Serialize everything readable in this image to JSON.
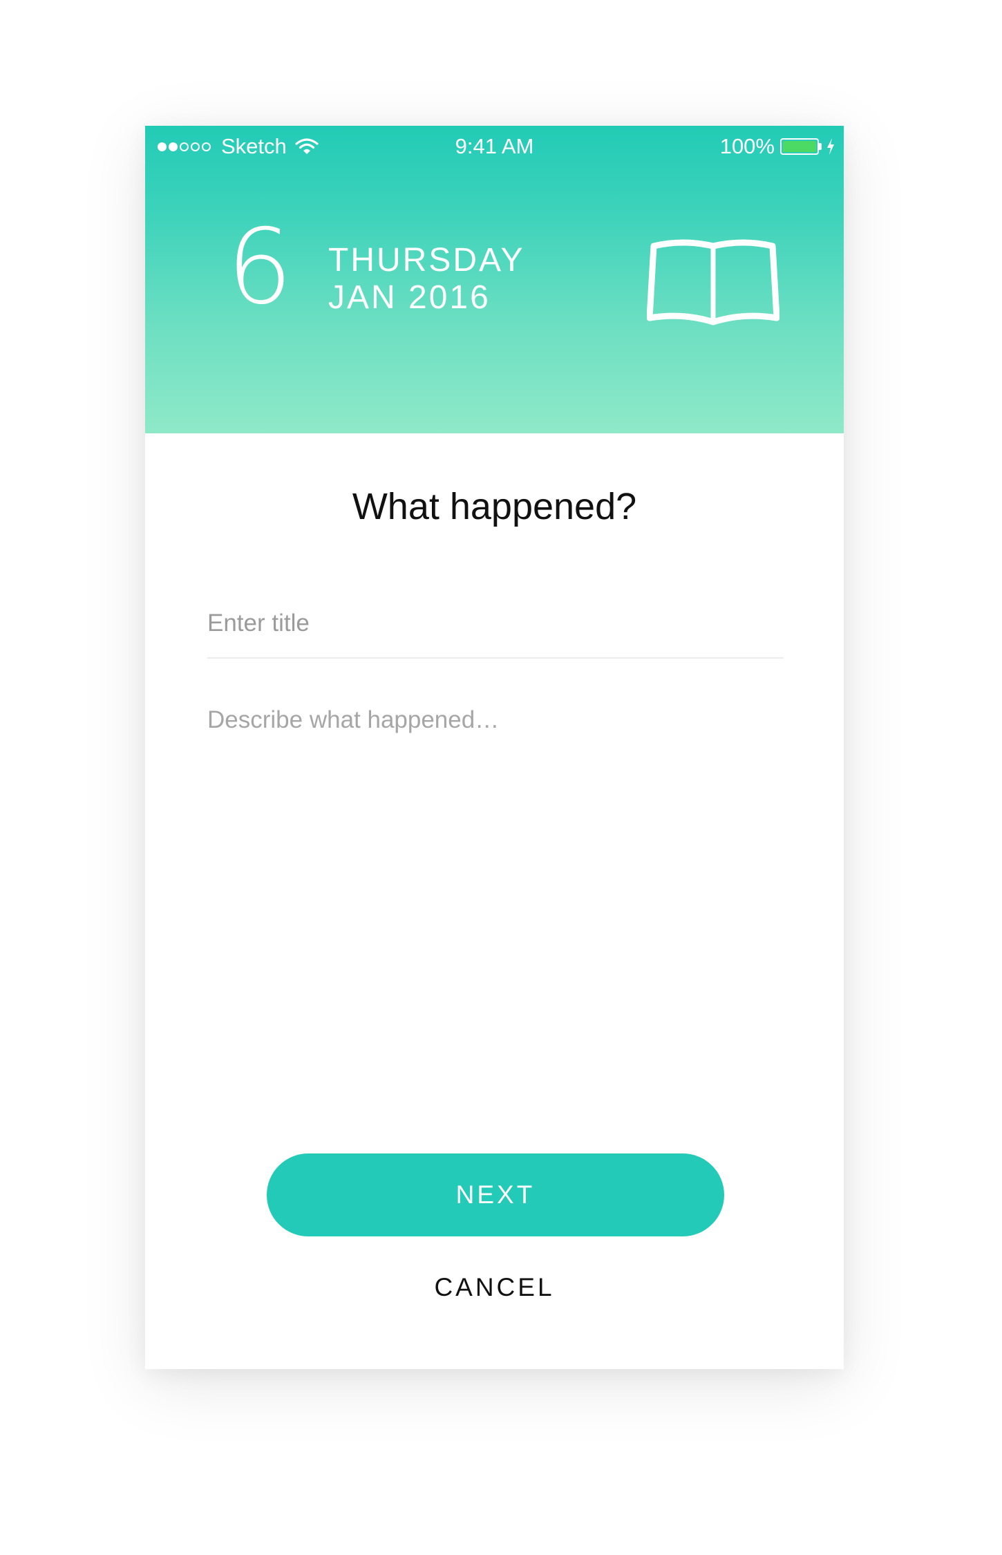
{
  "status_bar": {
    "signal_dots_filled": 2,
    "signal_dots_total": 5,
    "carrier": "Sketch",
    "time": "9:41 AM",
    "battery_percent_label": "100%",
    "battery_level": 1.0,
    "wifi_icon": "wifi-icon",
    "charging_icon": "bolt-icon"
  },
  "header": {
    "day_number": "6",
    "weekday": "THURSDAY",
    "month_year": "JAN 2016",
    "icon": "book-icon",
    "gradient_top": "#22cbb6",
    "gradient_bottom": "#8ee9c8"
  },
  "form": {
    "heading": "What happened?",
    "title_placeholder": "Enter title",
    "title_value": "",
    "description_placeholder": "Describe what happened…",
    "description_value": ""
  },
  "actions": {
    "next_label": "NEXT",
    "cancel_label": "CANCEL",
    "accent_color": "#22cab7"
  }
}
